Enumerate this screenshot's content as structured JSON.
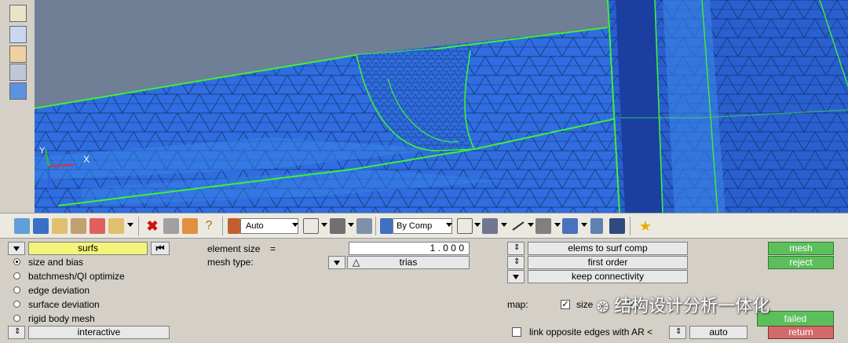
{
  "toolbar": {
    "auto_combo": "Auto",
    "bycomp_combo": "By Comp"
  },
  "panel": {
    "surfs_label": "surfs",
    "radio_options": [
      {
        "label": "size and bias",
        "selected": true
      },
      {
        "label": "batchmesh/QI optimize",
        "selected": false
      },
      {
        "label": "edge deviation",
        "selected": false
      },
      {
        "label": "surface deviation",
        "selected": false
      },
      {
        "label": "rigid body mesh",
        "selected": false
      }
    ],
    "interactive_label": "interactive",
    "element_size_label": "element size",
    "equals": "=",
    "element_size_value": "1 . 0 0 0",
    "mesh_type_label": "mesh type:",
    "mesh_type_value": "trias",
    "elems_to_surf_comp": "elems to surf comp",
    "first_order": "first order",
    "keep_connectivity": "keep connectivity",
    "map_label": "map:",
    "size_label": "size",
    "link_label": "link opposite edges with AR <",
    "auto_label": "auto",
    "mesh_btn": "mesh",
    "reject_btn": "reject",
    "failed_btn": "failed",
    "return_btn": "return"
  },
  "viewport": {
    "axis_x": "X",
    "axis_y": "Y"
  },
  "watermark": "结构设计分析一体化",
  "colors": {
    "mesh_blue": "#2f6de0",
    "edge_green": "#3cf03c",
    "sky_gray": "#6f7f95",
    "accent_green": "#5cbf5c",
    "accent_red": "#d26a6a"
  }
}
